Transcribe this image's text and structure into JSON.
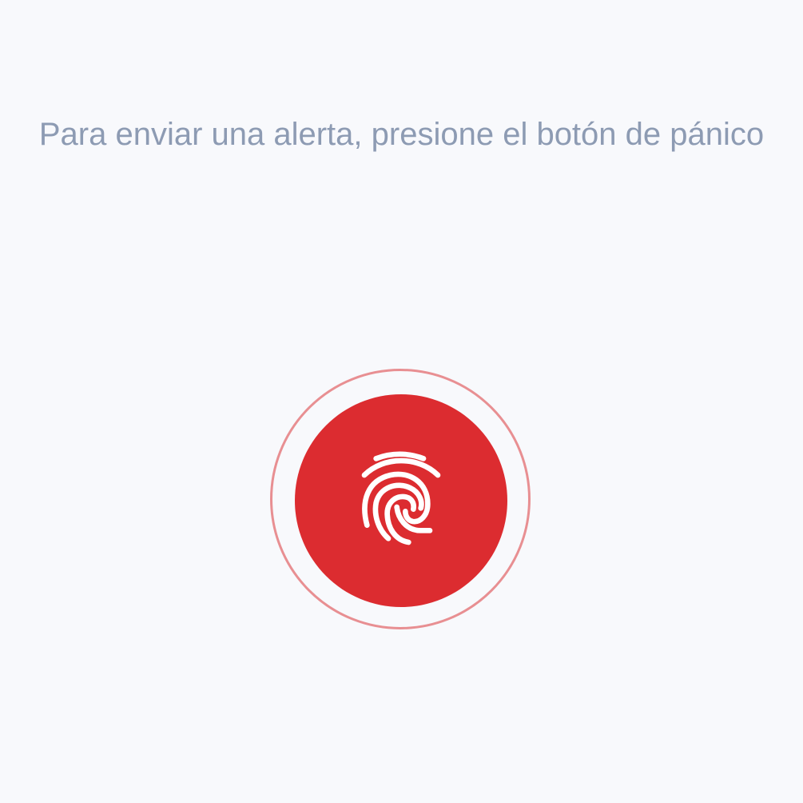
{
  "instruction_text": "Para enviar una alerta, presione el botón de pánico",
  "panic_button": {
    "icon": "fingerprint-icon",
    "color": "#dc2c30",
    "ring_color": "#e88f92"
  },
  "colors": {
    "background": "#f8f9fc",
    "text": "#8d9bb3"
  }
}
